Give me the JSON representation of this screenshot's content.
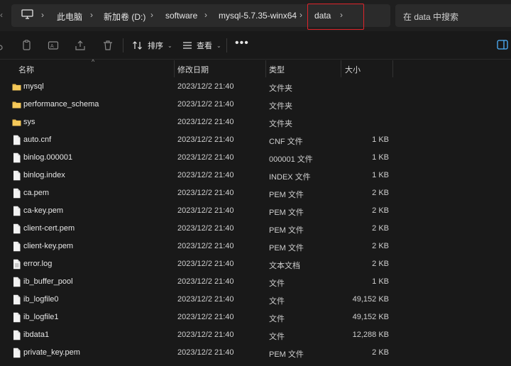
{
  "breadcrumbs": [
    "此电脑",
    "新加卷 (D:)",
    "software",
    "mysql-5.7.35-winx64",
    "data"
  ],
  "search": {
    "placeholder": "在 data 中搜索"
  },
  "toolbar": {
    "sort_label": "排序",
    "view_label": "查看",
    "more_label": "•••"
  },
  "columns": {
    "name": "名称",
    "date": "修改日期",
    "type": "类型",
    "size": "大小"
  },
  "files": [
    {
      "name": "mysql",
      "date": "2023/12/2 21:40",
      "type": "文件夹",
      "size": "",
      "icon": "folder-icon"
    },
    {
      "name": "performance_schema",
      "date": "2023/12/2 21:40",
      "type": "文件夹",
      "size": "",
      "icon": "folder-icon"
    },
    {
      "name": "sys",
      "date": "2023/12/2 21:40",
      "type": "文件夹",
      "size": "",
      "icon": "folder-icon"
    },
    {
      "name": "auto.cnf",
      "date": "2023/12/2 21:40",
      "type": "CNF 文件",
      "size": "1 KB",
      "icon": "file-icon"
    },
    {
      "name": "binlog.000001",
      "date": "2023/12/2 21:40",
      "type": "000001 文件",
      "size": "1 KB",
      "icon": "file-icon"
    },
    {
      "name": "binlog.index",
      "date": "2023/12/2 21:40",
      "type": "INDEX 文件",
      "size": "1 KB",
      "icon": "file-icon"
    },
    {
      "name": "ca.pem",
      "date": "2023/12/2 21:40",
      "type": "PEM 文件",
      "size": "2 KB",
      "icon": "file-icon"
    },
    {
      "name": "ca-key.pem",
      "date": "2023/12/2 21:40",
      "type": "PEM 文件",
      "size": "2 KB",
      "icon": "file-icon"
    },
    {
      "name": "client-cert.pem",
      "date": "2023/12/2 21:40",
      "type": "PEM 文件",
      "size": "2 KB",
      "icon": "file-icon"
    },
    {
      "name": "client-key.pem",
      "date": "2023/12/2 21:40",
      "type": "PEM 文件",
      "size": "2 KB",
      "icon": "file-icon"
    },
    {
      "name": "error.log",
      "date": "2023/12/2 21:40",
      "type": "文本文档",
      "size": "2 KB",
      "icon": "text-file-icon"
    },
    {
      "name": "ib_buffer_pool",
      "date": "2023/12/2 21:40",
      "type": "文件",
      "size": "1 KB",
      "icon": "file-icon"
    },
    {
      "name": "ib_logfile0",
      "date": "2023/12/2 21:40",
      "type": "文件",
      "size": "49,152 KB",
      "icon": "file-icon"
    },
    {
      "name": "ib_logfile1",
      "date": "2023/12/2 21:40",
      "type": "文件",
      "size": "49,152 KB",
      "icon": "file-icon"
    },
    {
      "name": "ibdata1",
      "date": "2023/12/2 21:40",
      "type": "文件",
      "size": "12,288 KB",
      "icon": "file-icon"
    },
    {
      "name": "private_key.pem",
      "date": "2023/12/2 21:40",
      "type": "PEM 文件",
      "size": "2 KB",
      "icon": "file-icon"
    }
  ],
  "colors": {
    "highlight": "#e0242b",
    "folder": "#f2c14e",
    "background": "#191919"
  }
}
